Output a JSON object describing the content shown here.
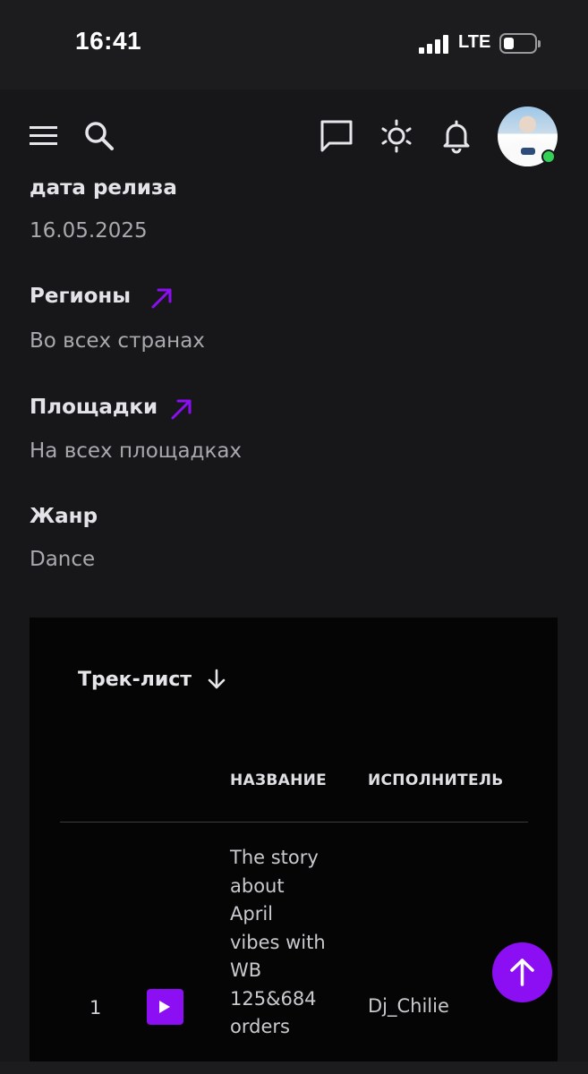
{
  "status_bar": {
    "time": "16:41",
    "network": "LTE"
  },
  "top_nav": {
    "icons": [
      "menu-icon",
      "search-icon",
      "chat-icon",
      "brightness-icon",
      "bell-icon"
    ],
    "avatar_status": "online"
  },
  "release": {
    "date_label": "дата релиза",
    "date_value": "16.05.2025",
    "regions_label": "Регионы",
    "regions_value": "Во всех странах",
    "platforms_label": "Площадки",
    "platforms_value": "На всех площадках",
    "genre_label": "Жанр",
    "genre_value": "Dance"
  },
  "tracklist": {
    "title": "Трек-лист",
    "columns": [
      "НАЗВАНИЕ",
      "ИСПОЛНИТЕЛЬ"
    ],
    "tracks": [
      {
        "number": "1",
        "title": "The story about April vibes with WB 125&684 orders",
        "artist": "Dj_Chilie"
      }
    ]
  },
  "colors": {
    "accent": "#8b0ff2",
    "background": "#17171a",
    "panel": "#050505",
    "online": "#34d058"
  }
}
